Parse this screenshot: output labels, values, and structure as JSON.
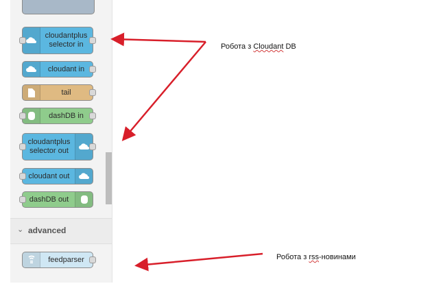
{
  "palette": {
    "nodes": [
      {
        "label": "cloudantplus\nselector in",
        "icon": "cloud-icon"
      },
      {
        "label": "cloudant in",
        "icon": "cloud-icon"
      },
      {
        "label": "tail",
        "icon": "file-icon"
      },
      {
        "label": "dashDB in",
        "icon": "database-icon"
      },
      {
        "label": "cloudantplus\nselector out",
        "icon": "cloud-icon"
      },
      {
        "label": "cloudant out",
        "icon": "cloud-icon"
      },
      {
        "label": "dashDB out",
        "icon": "database-icon"
      }
    ],
    "advanced": {
      "label": "advanced",
      "chevron": "⌄",
      "nodes": [
        {
          "label": "feedparser",
          "icon": "rss-icon"
        }
      ]
    }
  },
  "annotations": {
    "cloudant": {
      "prefix": "Робота з ",
      "highlight": "Cloudant",
      "suffix": " DB"
    },
    "rss": {
      "prefix": "Робота з ",
      "highlight": "rss",
      "suffix": "-новинами"
    }
  },
  "colors": {
    "storage_node": "#5bb7e0",
    "file_node": "#dfba82",
    "db_node": "#8fcc8c",
    "feed_node": "#cfe7f4",
    "arrow": "#d81f2a"
  }
}
